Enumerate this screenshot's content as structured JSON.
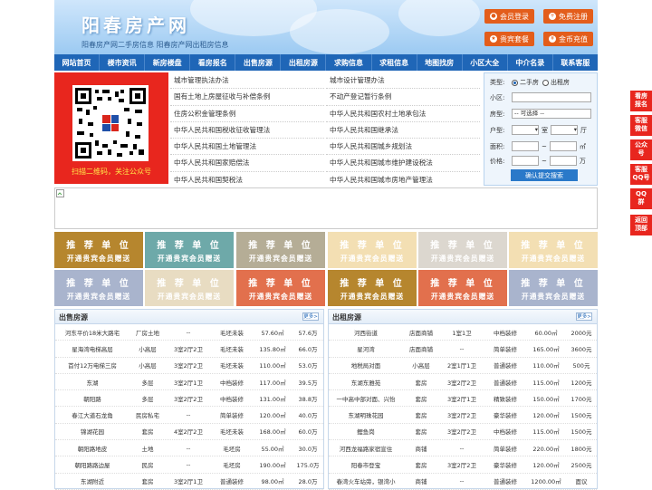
{
  "header": {
    "title": "阳春房产网",
    "subtitle": "阳春房产网二手房信息    阳春房产网出租房信息",
    "buttons": [
      "会员登录",
      "免费注册",
      "贵宾套餐",
      "金币充值"
    ]
  },
  "nav": [
    "网站首页",
    "楼市资讯",
    "新房楼盘",
    "看房报名",
    "出售房源",
    "出租房源",
    "求购信息",
    "求租信息",
    "地图找房",
    "小区大全",
    "中介名录",
    "联系客服"
  ],
  "qr_caption": "扫描二维码，关注公众号",
  "laws_left": [
    "城市管理执法办法",
    "国有土地上房屋征收与补偿条例",
    "住房公积金管理条例",
    "中华人民共和国税收征收管理法",
    "中华人民共和国土地管理法",
    "中华人民共和国家赔偿法",
    "中华人民共和国契税法"
  ],
  "laws_right": [
    "城市设计管理办法",
    "不动产登记暂行条例",
    "中华人民共和国农村土地承包法",
    "中华人民共和国继承法",
    "中华人民共和国城乡规划法",
    "中华人民共和国城市维护建设税法",
    "中华人民共和国城市房地产管理法"
  ],
  "search": {
    "type_label": "类型:",
    "type_opt1": "二手房",
    "type_opt2": "出租房",
    "community_label": "小区:",
    "house_label": "房型:",
    "house_value": "-- 可选择 --",
    "layout_label": "户型:",
    "room_unit": "室",
    "hall_unit": "厅",
    "area_label": "面积:",
    "area_unit": "㎡",
    "price_label": "价格:",
    "price_unit": "万",
    "tilde": "~",
    "submit": "确认提交搜索"
  },
  "ads": {
    "line1": "推 荐 单 位",
    "line2": "开通贵宾会员赠送"
  },
  "sale_panel": {
    "title": "出售房源",
    "more": "更多>",
    "rows": [
      [
        "河东平价18米大路宅",
        "厂房土地",
        "--",
        "毛坯未装",
        "57.60㎡",
        "57.6万"
      ],
      [
        "星海湾电梯高层",
        "小高层",
        "3室2厅2卫",
        "毛坯未装",
        "135.80㎡",
        "66.0万"
      ],
      [
        "首付12万电梯三房",
        "小高层",
        "3室2厅2卫",
        "毛坯未装",
        "110.00㎡",
        "53.0万"
      ],
      [
        "东湖",
        "多层",
        "3室2厅1卫",
        "中档装修",
        "117.00㎡",
        "39.5万"
      ],
      [
        "朝阳路",
        "多层",
        "3室2厅2卫",
        "中档装修",
        "131.00㎡",
        "38.8万"
      ],
      [
        "春江大道石龙角",
        "民房私宅",
        "--",
        "简单装修",
        "120.00㎡",
        "40.0万"
      ],
      [
        "锦湖花园",
        "套房",
        "4室2厅2卫",
        "毛坯未装",
        "168.00㎡",
        "60.0万"
      ],
      [
        "朝阳路地皮",
        "土地",
        "--",
        "毛坯房",
        "55.00㎡",
        "30.0万"
      ],
      [
        "朝阳路路边屋",
        "民房",
        "--",
        "毛坯房",
        "190.00㎡",
        "175.0万"
      ],
      [
        "东湖附近",
        "套房",
        "3室2厅1卫",
        "普通装修",
        "98.00㎡",
        "28.0万"
      ]
    ]
  },
  "rent_panel": {
    "title": "出租房源",
    "more": "更多>",
    "rows": [
      [
        "河西街道",
        "店面商铺",
        "1室1卫",
        "中档装修",
        "60.00㎡",
        "2000元"
      ],
      [
        "星河湾",
        "店面商铺",
        "--",
        "简单装修",
        "165.00㎡",
        "3600元"
      ],
      [
        "地税局对面",
        "小高层",
        "2室1厅1卫",
        "普通装修",
        "110.00㎡",
        "500元"
      ],
      [
        "东湖东雅苑",
        "套房",
        "3室2厅2卫",
        "普通装修",
        "115.00㎡",
        "1200元"
      ],
      [
        "一中高中部对面、兴怡",
        "套房",
        "3室2厅1卫",
        "精致装修",
        "150.00㎡",
        "1700元"
      ],
      [
        "东湖明珠花园",
        "套房",
        "3室2厅2卫",
        "豪华装修",
        "120.00㎡",
        "1500元"
      ],
      [
        "鲤鱼岗",
        "套房",
        "3室2厅2卫",
        "中档装修",
        "115.00㎡",
        "1500元"
      ],
      [
        "河西龙福路家宿宣住",
        "商铺",
        "--",
        "简单装修",
        "220.00㎡",
        "1800元"
      ],
      [
        "阳春市登宝",
        "套房",
        "3室2厅2卫",
        "豪华装修",
        "120.00㎡",
        "2500元"
      ],
      [
        "春湾火车站旁，银湾小",
        "商铺",
        "--",
        "普通装修",
        "1200.00㎡",
        "面议"
      ]
    ]
  },
  "sidebar": [
    [
      "看房",
      "报名"
    ],
    [
      "客服",
      "微信"
    ],
    [
      "公众",
      "号"
    ],
    [
      "客服",
      "QQ号"
    ],
    [
      "QQ",
      "群"
    ],
    [
      "返回",
      "顶部"
    ]
  ]
}
